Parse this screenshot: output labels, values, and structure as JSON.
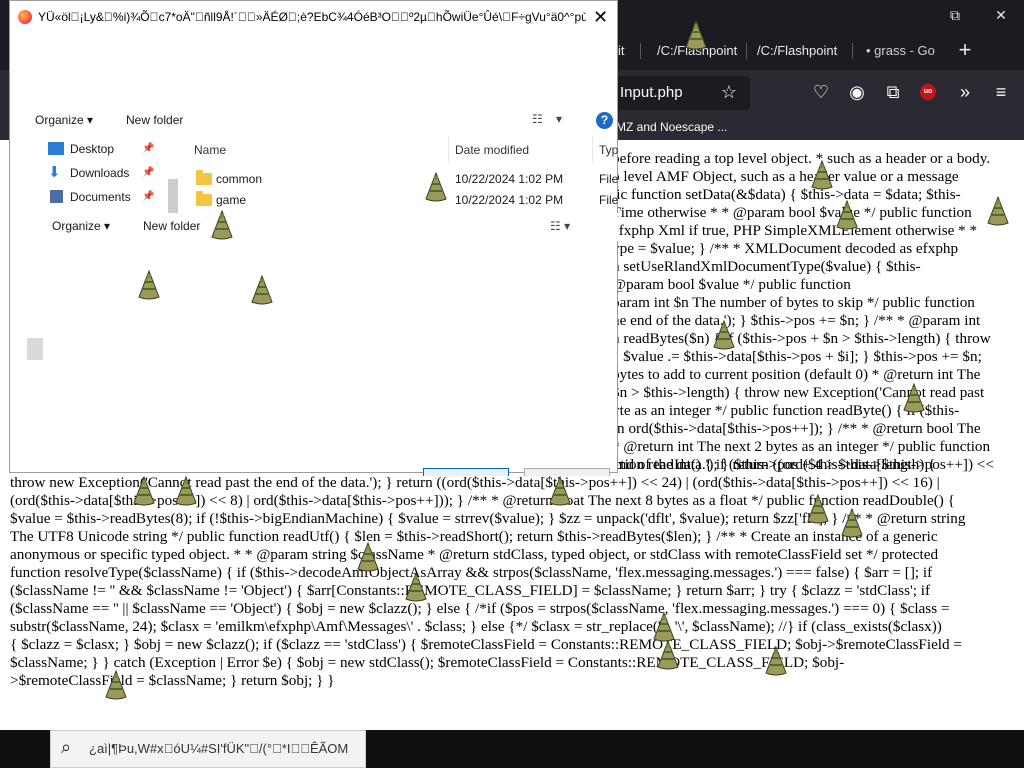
{
  "browser": {
    "tabs": [
      {
        "label": "/C:/Flashpoint"
      },
      {
        "label": "/C:/Flashpoint"
      },
      {
        "label": "grass - Go"
      }
    ],
    "new_tab_label": "+",
    "window_controls": {
      "minimize": "—",
      "restore": "⧉",
      "close": "✕"
    },
    "url_text": "Input.php",
    "bookmark_text": "MZ and Noescape ..."
  },
  "page": {
    "code_lines": [
      "8) | ord($this->data[$this->pos++]); } /** * @return int The next 4 bytes as an integer */ public function readInt() { if ($this->pos + 4 > $this->length) {",
      "throw new Exception('Cannot read past the end of the data.'); } return ((ord($this->data[$this->pos++]) << 24) | (ord($this->data[$this->pos++]) << 16) |",
      "(ord($this->data[$this->pos++]) << 8) | ord($this->data[$this->pos++])); } /** * @return float The next 8 bytes as a float */ public function readDouble() {",
      "$value = $this->readBytes(8); if (!$this->bigEndianMachine) { $value = strrev($value); } $zz = unpack('dflt', $value); return $zz['flt']; } /** * @return string",
      "The UTF8 Unicode string */ public function readUtf() { $len = $this->readShort(); return $this->readBytes($len); } /** * Create an instance of a generic",
      "anonymous or specific typed object. * * @param string $className * @return stdClass, typed object, or stdClass with remoteClassField set */ protected",
      "function resolveType($className) { if ($this->decodeAmfObjectAsArray && strpos($className, 'flex.messaging.messages.') === false) { $arr = []; if",
      "($className != '' && $className != 'Object') { $arr[Constants::REMOTE_CLASS_FIELD] = $className; } return $arr; } try { $clazz = 'stdClass'; if",
      "($className == '' || $className == 'Object') { $obj = new $clazz(); } else { /*if ($pos = strpos($className, 'flex.messaging.messages.') === 0) { $class =",
      "substr($className, 24); $clasx = 'emilkm\\efxphp\\Amf\\Messages\\' . $class; } else {*/ $clasx = str_replace('.', '\\', $className); //} if (class_exists($clasx))",
      "{ $clazz = $clasx; } $obj = new $clazz(); if ($clazz == 'stdClass') { $remoteClassField = Constants::REMOTE_CLASS_FIELD; $obj->$remoteClassField =",
      "$className; } } catch (Exception | Error $e) { $obj = new stdClass(); $remoteClassField = Constants::REMOTE_CLASS_FIELD; $obj-",
      ">$remoteClassField = $className; } return $obj; } }"
    ],
    "right_lines": [
      "before reading a top level object. * such as a header or a body.",
      "p level AMF Object, such as a header value or a message",
      "lic function setData(&$data) { $this->data = $data; $this-",
      "Time otherwise * * @param bool $value */ public function",
      "efxphp Xml if true, PHP SimpleXMLElement otherwise * *",
      "ype = $value; } /** * XMLDocument decoded as efxphp",
      "n setUseRlandXmlDocumentType($value) { $this-",
      "@param bool $value */ public function",
      "param int $n The number of bytes to skip */ public function",
      "he end of the data.'); } $this->pos += $n; } /** * @param int",
      "n readBytes($n) { if ($this->pos + $n > $this->length) { throw",
      "{ $value .= $this->data[$this->pos + $i]; } $this->pos += $n;",
      "bytes to add to current position (default 0) * @return int The",
      "$n > $this->length) { throw new Exception('Cannot read past",
      "yte as an integer */ public function readByte() { if ($this-",
      "rn ord($this->data[$this->pos++]); } /** * @return bool The",
      "* @return int The next 2 bytes as an integer */ public function",
      "end of the data.'); } return ((ord($this->data[$this->pos++]) <<"
    ]
  },
  "dialog": {
    "title": "YÜ«öl\u0000¡Ly&\u0000%i)¾Õ\u0000c7*oÄ\"\u0000ñll9Å!´\u0000\u0000»ÄÉØ\u0000;è?EbC¾4ÓéB³O\u0000\u0000º2µ\u0000hÕwiÜe°Ûé\\\u0000F÷gVu°ä0^°pù...",
    "close_label": "✕",
    "toolbar": {
      "organize": "Organize",
      "new_folder": "New folder",
      "help": "?"
    },
    "nav_items": [
      {
        "label": "Desktop",
        "icon": "desktop-icon",
        "color": "#2b7cd3"
      },
      {
        "label": "Downloads",
        "icon": "downloads-icon",
        "color": "#2b7cd3"
      },
      {
        "label": "Documents",
        "icon": "documents-icon",
        "color": "#4a6fa5"
      }
    ],
    "columns": {
      "name": "Name",
      "date": "Date modified",
      "type": "Typ"
    },
    "files": [
      {
        "name": "common",
        "date": "10/22/2024 1:02 PM",
        "type": "File"
      },
      {
        "name": "game",
        "date": "10/22/2024 1:02 PM",
        "type": "File"
      }
    ],
    "ghost_toolbar": {
      "organize": "Organize",
      "new_folder": "New folder"
    }
  },
  "taskbar": {
    "search_placeholder": "¿aì|¶Þu,W#x\u0000óU¼#SI'fÜK\"\u0000/(°\u0000*I\u0000\u0000ÊÃOM"
  },
  "colors": {
    "browser_dark": "#1c1b22",
    "toolbar": "#2b2a33",
    "accent": "#0067c0",
    "folder": "#f4c542"
  }
}
